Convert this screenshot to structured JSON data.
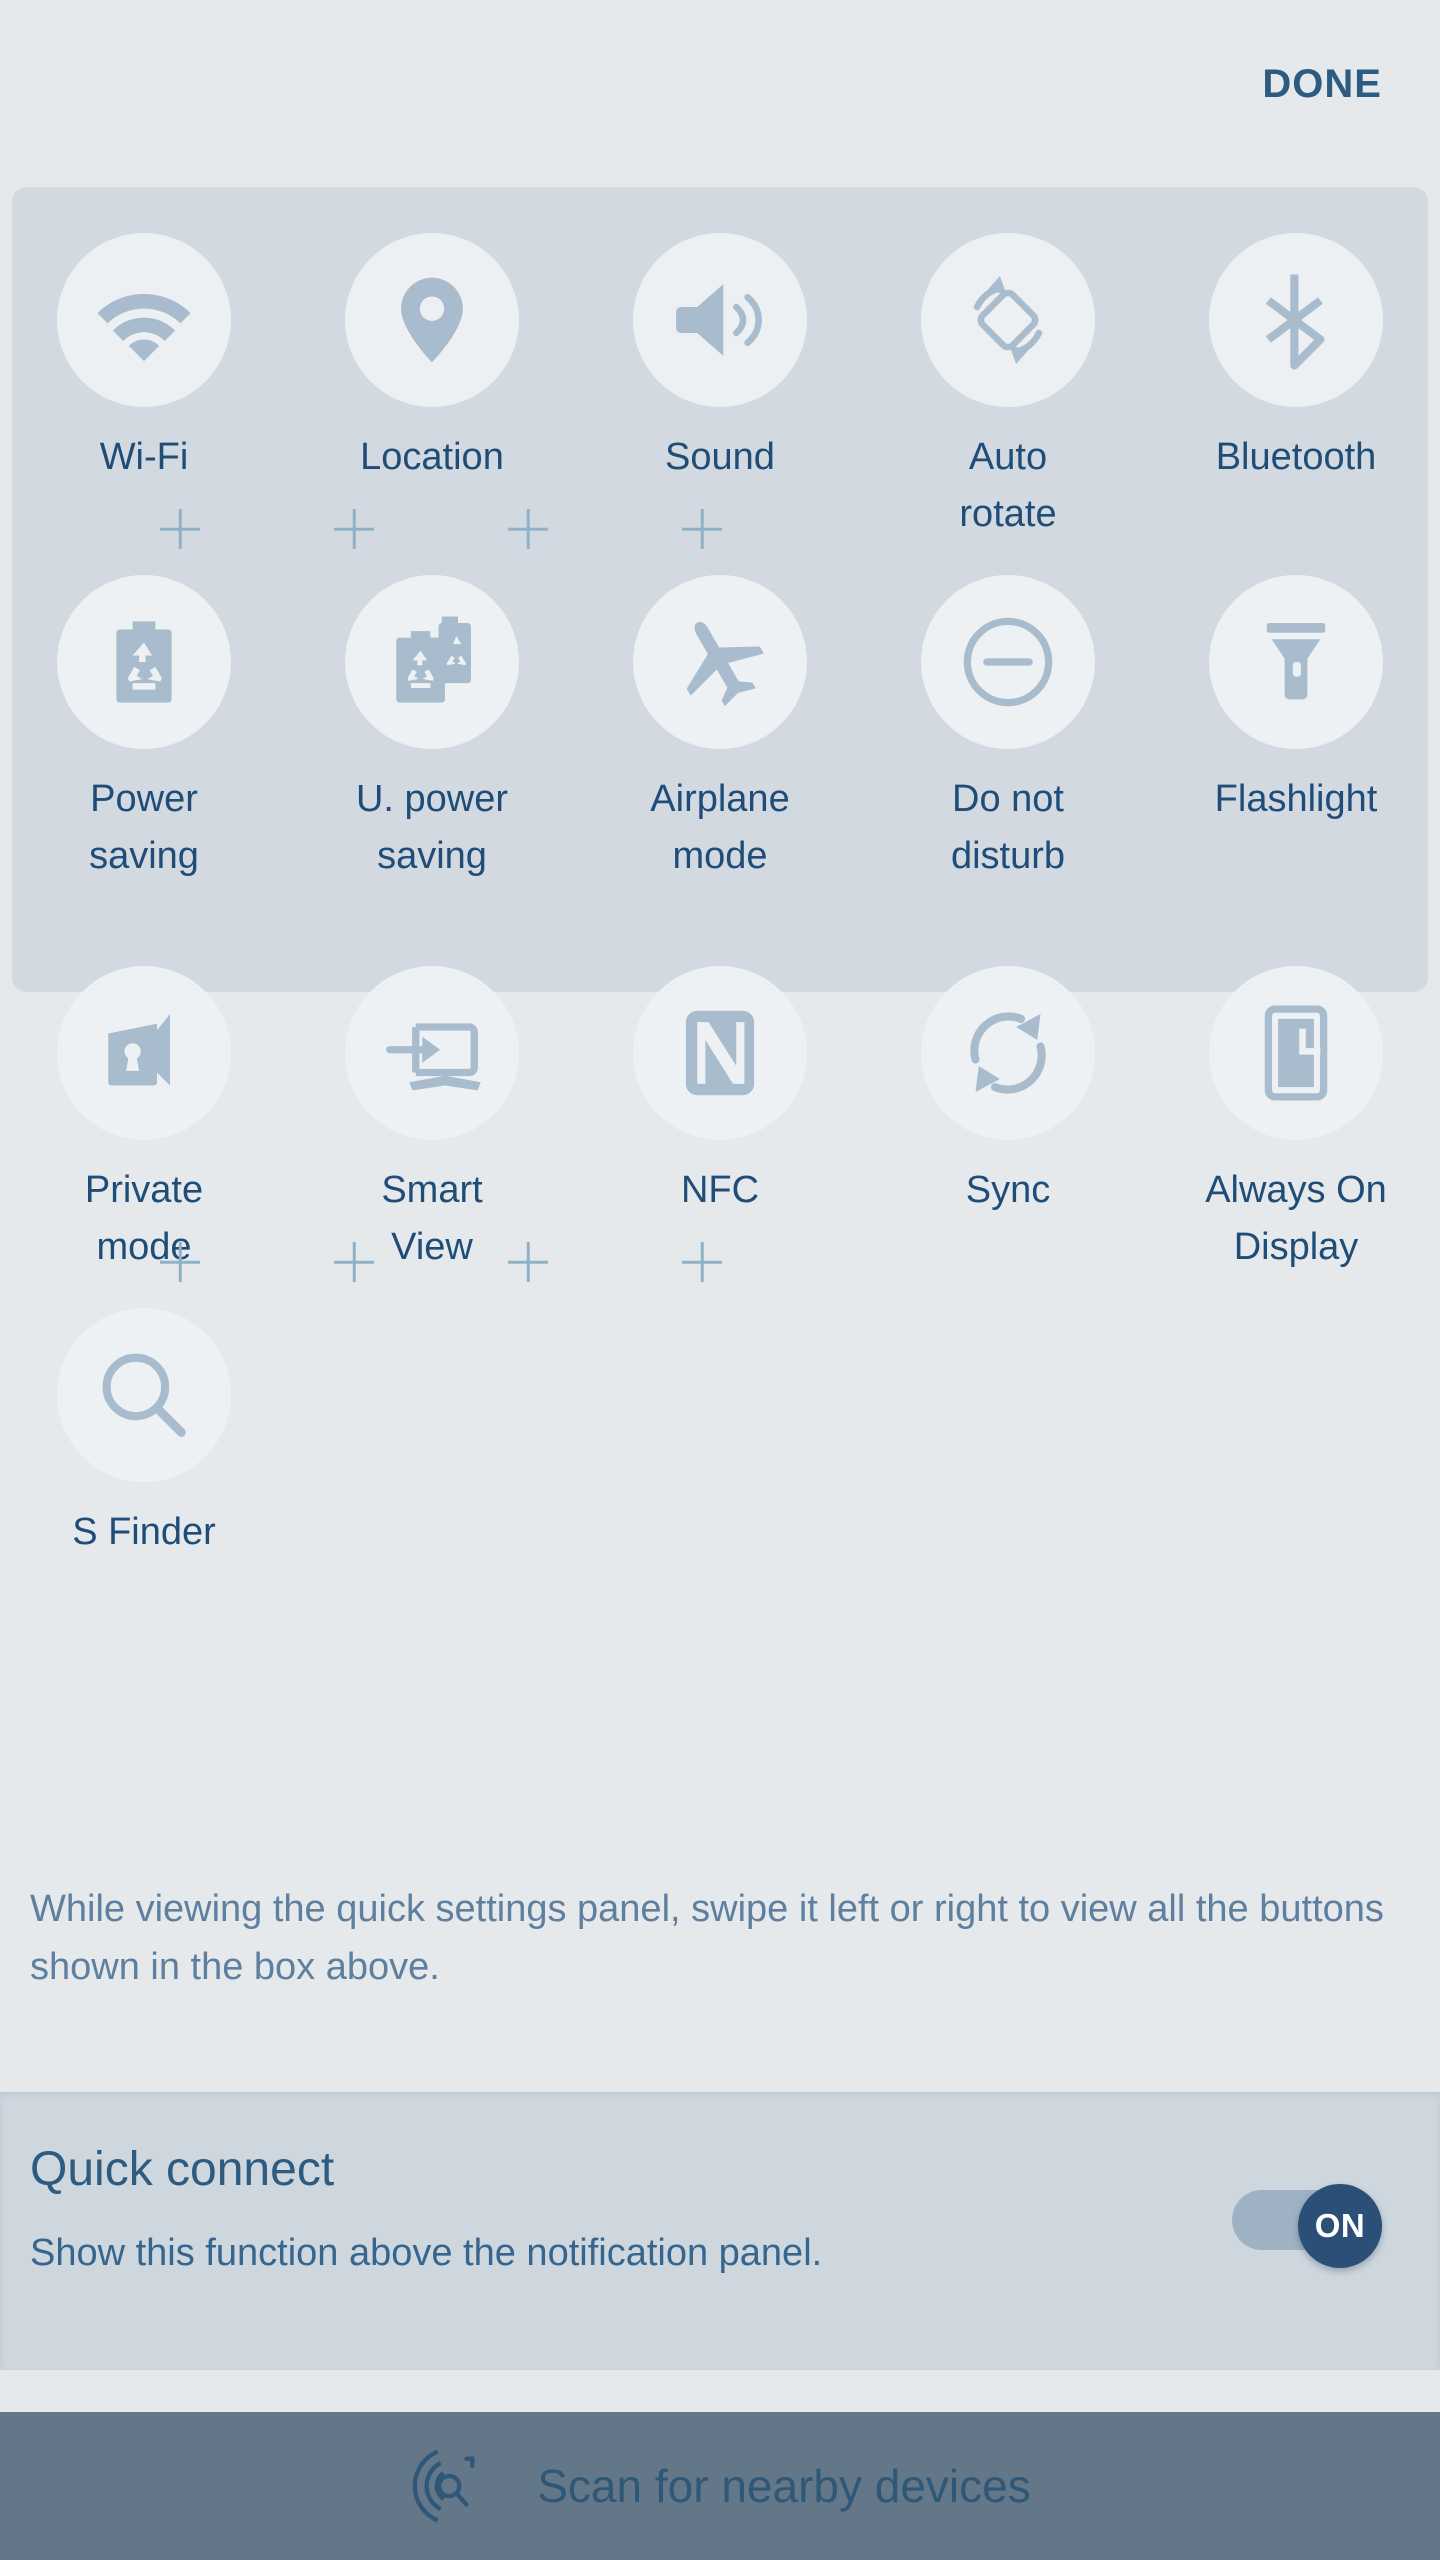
{
  "header": {
    "done_label": "DONE"
  },
  "panel": {
    "tiles": [
      {
        "label": "Wi-Fi",
        "icon": "wifi-icon",
        "highlighted": true
      },
      {
        "label": "Location",
        "icon": "location-pin-icon",
        "highlighted": true
      },
      {
        "label": "Sound",
        "icon": "speaker-icon",
        "highlighted": true
      },
      {
        "label": "Auto\nrotate",
        "icon": "auto-rotate-icon",
        "highlighted": true
      },
      {
        "label": "Bluetooth",
        "icon": "bluetooth-icon",
        "highlighted": true
      },
      {
        "label": "Power\nsaving",
        "icon": "battery-recycle-icon",
        "highlighted": true
      },
      {
        "label": "U. power\nsaving",
        "icon": "double-battery-recycle-icon",
        "highlighted": true
      },
      {
        "label": "Airplane\nmode",
        "icon": "airplane-icon",
        "highlighted": true
      },
      {
        "label": "Do not\ndisturb",
        "icon": "do-not-disturb-icon",
        "highlighted": true
      },
      {
        "label": "Flashlight",
        "icon": "flashlight-icon",
        "highlighted": true
      },
      {
        "label": "Private\nmode",
        "icon": "private-folder-lock-icon",
        "highlighted": false
      },
      {
        "label": "Smart\nView",
        "icon": "smart-view-tv-icon",
        "highlighted": false
      },
      {
        "label": "NFC",
        "icon": "nfc-icon",
        "highlighted": false
      },
      {
        "label": "Sync",
        "icon": "sync-icon",
        "highlighted": false
      },
      {
        "label": "Always On\nDisplay",
        "icon": "always-on-display-icon",
        "highlighted": false
      },
      {
        "label": "S Finder",
        "icon": "magnifier-icon",
        "highlighted": false
      }
    ],
    "labels": {
      "wifi": "Wi-Fi",
      "location": "Location",
      "sound": "Sound",
      "auto_rotate_line1": "Auto",
      "auto_rotate_line2": "rotate",
      "bluetooth": "Bluetooth",
      "power_saving_line1": "Power",
      "power_saving_line2": "saving",
      "u_power_saving_line1": "U. power",
      "u_power_saving_line2": "saving",
      "airplane_line1": "Airplane",
      "airplane_line2": "mode",
      "dnd_line1": "Do not",
      "dnd_line2": "disturb",
      "flashlight": "Flashlight",
      "private_line1": "Private",
      "private_line2": "mode",
      "smartview_line1": "Smart",
      "smartview_line2": "View",
      "nfc": "NFC",
      "sync": "Sync",
      "aod_line1": "Always On",
      "aod_line2": "Display",
      "sfinder": "S Finder"
    }
  },
  "hint": {
    "text": "While viewing the quick settings panel, swipe it left or right to view all the buttons shown in the box above."
  },
  "quick_connect": {
    "title": "Quick connect",
    "subtitle": "Show this function above the notification panel.",
    "toggle_state": "ON"
  },
  "bottom_bar": {
    "scan_label": "Scan for nearby devices",
    "icon": "scan-radar-icon"
  },
  "colors": {
    "background": "#e5e9ec",
    "highlight_box": "#d2d9e0",
    "tile_circle": "#edf1f3",
    "icon": "#a8bccd",
    "label_text": "#1f4d78",
    "accent": "#2e5b80",
    "hint_text": "#5e7f9e",
    "quick_connect_bg": "#ced7de",
    "toggle_knob": "#2b4f76",
    "toggle_track": "#9fb2c4",
    "bottom_bar_bg": "#647789",
    "plus_mark": "#8fb2c8"
  }
}
